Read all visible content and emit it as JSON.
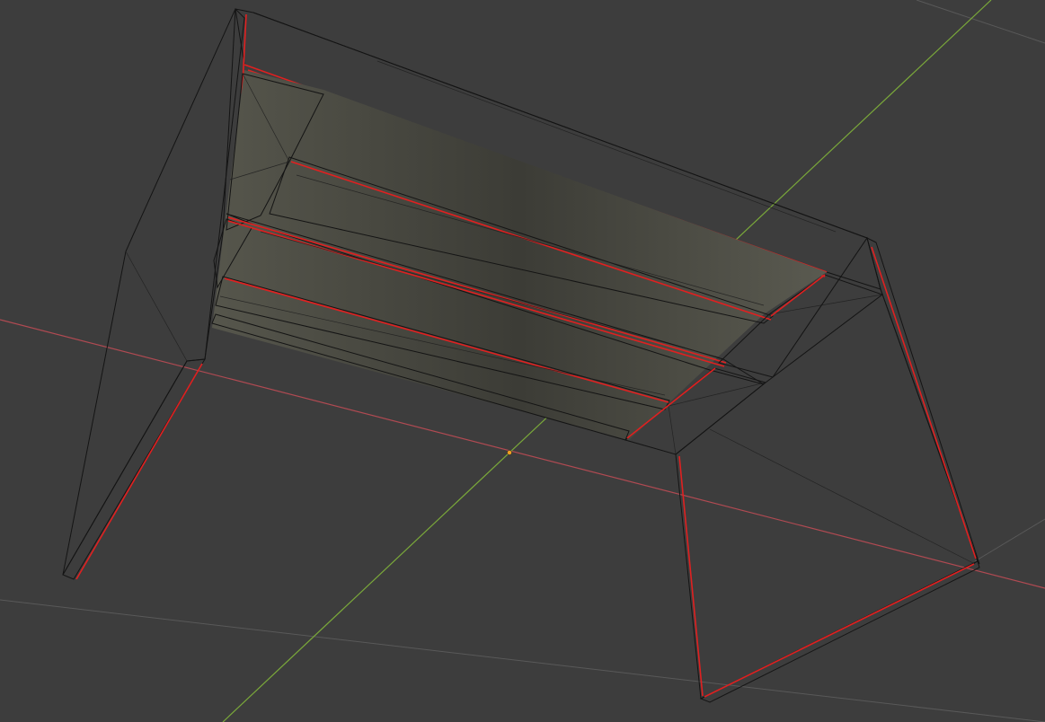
{
  "viewport": {
    "background": "#3d3d3d",
    "grid_color": "#595959",
    "x_axis_color": "#b04a52",
    "y_axis_color": "#7aa83a",
    "origin_color": "#f0a020",
    "mesh_face_color": "#78786a",
    "mesh_edge_color": "#141414",
    "sharp_edge_color": "#e02020"
  },
  "scene": {
    "object_icon": "mesh-cube-icon",
    "origin_icon": "object-origin-icon"
  }
}
